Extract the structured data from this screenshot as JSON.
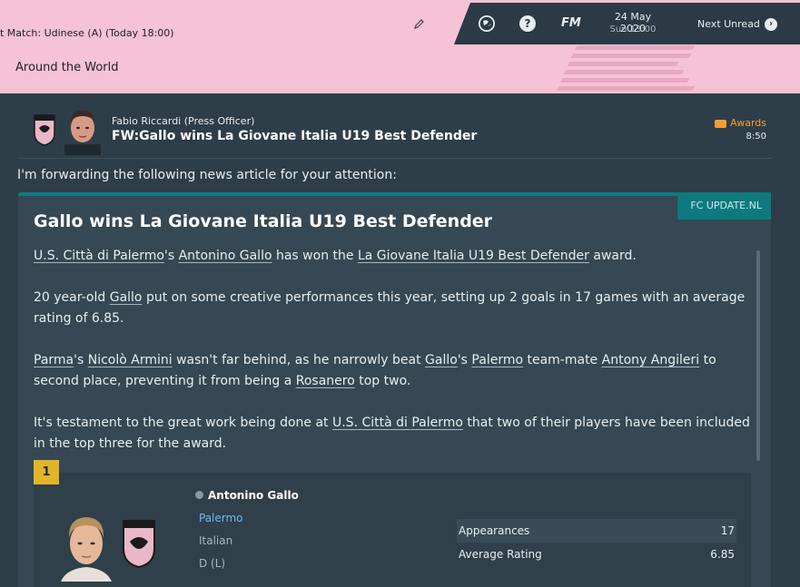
{
  "header": {
    "next_match": "t Match: Udinese (A) (Today 18:00)",
    "section_title": "Around the World"
  },
  "topnav": {
    "fm_label": "FM",
    "date": "24 May 2020",
    "time": "Sun 13:00",
    "next_unread": "Next Unread"
  },
  "message": {
    "sender": "Fabio Riccardi  (Press Officer)",
    "subject": "FW:Gallo wins La Giovane Italia U19 Best Defender",
    "category": "Awards",
    "time": "8:50",
    "intro": "I'm forwarding the following news article for your attention:"
  },
  "article": {
    "source": "FC UPDATE.NL",
    "headline": "Gallo wins La Giovane Italia U19 Best Defender",
    "p1": {
      "club": "U.S. Città di Palermo",
      "s1": "'s ",
      "player": "Antonino Gallo",
      "s2": " has won the ",
      "award": "La Giovane Italia U19 Best Defender",
      "s3": " award."
    },
    "p2": {
      "s1": "20 year-old ",
      "player": "Gallo",
      "s2": " put on some creative performances this year, setting up 2 goals in 17 games with an average rating of 6.85."
    },
    "p3": {
      "club1": "Parma",
      "s1": "'s ",
      "player1": "Nicolò Armini",
      "s2": " wasn't far behind, as he narrowly beat ",
      "player2": "Gallo",
      "s3": "'s ",
      "club2": "Palermo",
      "s4": " team-mate ",
      "player3": "Antony Angileri",
      "s5": " to second place, preventing it from being a ",
      "nickname": "Rosanero",
      "s6": " top two."
    },
    "p4": {
      "s1": "It's testament to the great work being done at ",
      "club": "U.S. Città di Palermo",
      "s2": " that two of their players have been included in the top three for the award."
    }
  },
  "winner": {
    "rank": "1",
    "name": "Antonino Gallo",
    "club": "Palermo",
    "nationality": "Italian",
    "position": "D (L)",
    "stats": [
      {
        "label": "Appearances",
        "value": "17"
      },
      {
        "label": "Average Rating",
        "value": "6.85"
      }
    ]
  },
  "colors": {
    "header_pink": "#f5c2d6",
    "panel_dark": "#2e3e48",
    "accent_teal": "#0e7a80",
    "award_orange": "#f0a030",
    "rank_gold": "#e2b42a",
    "link_blue": "#6fb6ff"
  }
}
